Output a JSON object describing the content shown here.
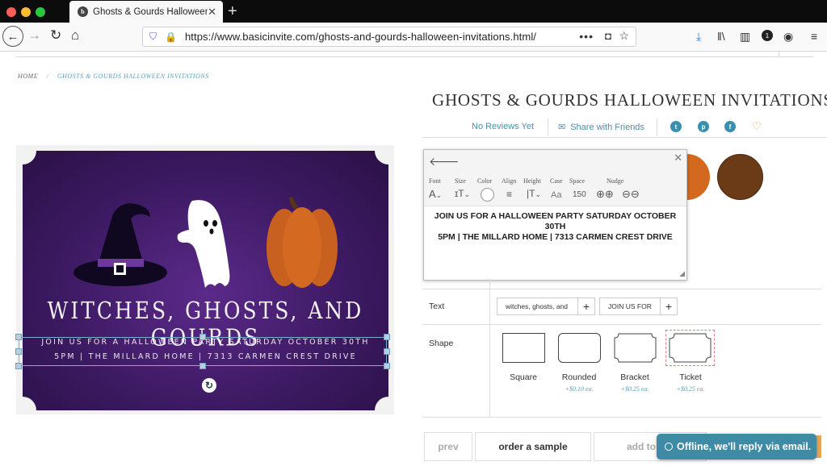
{
  "browser": {
    "tab_title": "Ghosts & Gourds Halloween In",
    "url": "https://www.basicinvite.com/ghosts-and-gourds-halloween-invitations.html/"
  },
  "breadcrumb": {
    "home": "HOME",
    "current": "GHOSTS & GOURDS HALLOWEEN INVITATIONS"
  },
  "product": {
    "title": "GHOSTS & GOURDS HALLOWEEN INVITATIONS",
    "reviews": "No Reviews Yet",
    "share": "Share with Friends"
  },
  "card": {
    "title": "WITCHES, GHOSTS, AND GOURDS",
    "line1": "JOIN US FOR A HALLOWEEN PARTY SATURDAY OCTOBER 30TH",
    "line2": "5PM | THE MILLARD HOME | 7313 CARMEN CREST DRIVE",
    "bg_color": "#3d1a63"
  },
  "swatches": [
    "#d2691e",
    "#6b3a16"
  ],
  "toolbar": {
    "labels": {
      "font": "Font",
      "size": "Size",
      "color": "Color",
      "align": "Align",
      "height": "Height",
      "case": "Case",
      "space": "Space",
      "nudge": "Nudge"
    },
    "font_ctrl": "A",
    "case_ctrl": "Aa",
    "space_value": "150",
    "text_line1": "JOIN US FOR A HALLOWEEN PARTY SATURDAY OCTOBER",
    "text_line2": "30TH",
    "text_line3": "5PM | THE MILLARD HOME | 7313 CARMEN CREST DRIVE"
  },
  "editor": {
    "text_label": "Text",
    "text_btn1": "witches, ghosts, and",
    "text_btn2": "JOIN US FOR",
    "shape_label": "Shape",
    "shapes": [
      {
        "name": "Square",
        "price": ""
      },
      {
        "name": "Rounded",
        "price": "+$0.10 ea."
      },
      {
        "name": "Bracket",
        "price": "+$0.25 ea."
      },
      {
        "name": "Ticket",
        "price": "+$0.25 ea."
      }
    ]
  },
  "bottom": {
    "prev": "prev",
    "sample": "order a sample",
    "add": "add to"
  },
  "chat": {
    "label": "Offline, we'll reply via email."
  },
  "colors": {
    "accent": "#3f8aa5",
    "link": "#4a90a8"
  }
}
